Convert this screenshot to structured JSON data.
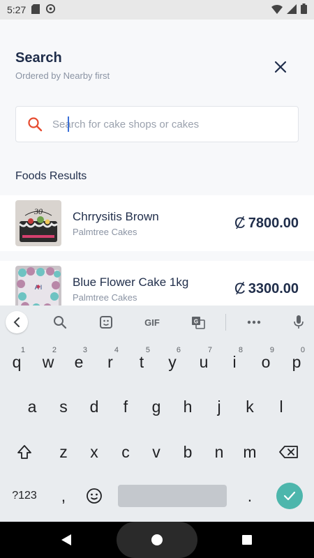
{
  "status_bar": {
    "time": "5:27"
  },
  "header": {
    "title": "Search",
    "subtitle": "Ordered by Nearby first"
  },
  "search": {
    "placeholder": "Search for cake shops or cakes",
    "value": ""
  },
  "section": {
    "title": "Foods Results"
  },
  "results": [
    {
      "name": "Chrrysitis  Brown",
      "shop": "Palmtree Cakes",
      "currency_symbol": "Ȼ",
      "price": "7800.00"
    },
    {
      "name": "Blue Flower Cake 1kg",
      "shop": "Palmtree Cakes",
      "currency_symbol": "Ȼ",
      "price": "3300.00"
    }
  ],
  "keyboard": {
    "toolbar": {
      "gif_label": "GIF"
    },
    "row1": [
      {
        "k": "q",
        "n": "1"
      },
      {
        "k": "w",
        "n": "2"
      },
      {
        "k": "e",
        "n": "3"
      },
      {
        "k": "r",
        "n": "4"
      },
      {
        "k": "t",
        "n": "5"
      },
      {
        "k": "y",
        "n": "6"
      },
      {
        "k": "u",
        "n": "7"
      },
      {
        "k": "i",
        "n": "8"
      },
      {
        "k": "o",
        "n": "9"
      },
      {
        "k": "p",
        "n": "0"
      }
    ],
    "row2": [
      "a",
      "s",
      "d",
      "f",
      "g",
      "h",
      "j",
      "k",
      "l"
    ],
    "row3": [
      "z",
      "x",
      "c",
      "v",
      "b",
      "n",
      "m"
    ],
    "symbols_label": "?123",
    "comma": ",",
    "period": "."
  },
  "colors": {
    "accent": "#e64a2e",
    "text_primary": "#1f2d4a",
    "text_secondary": "#8a93a3",
    "enter_key": "#4db6ac"
  },
  "icons": {
    "search": "search-icon",
    "close": "close-icon"
  }
}
